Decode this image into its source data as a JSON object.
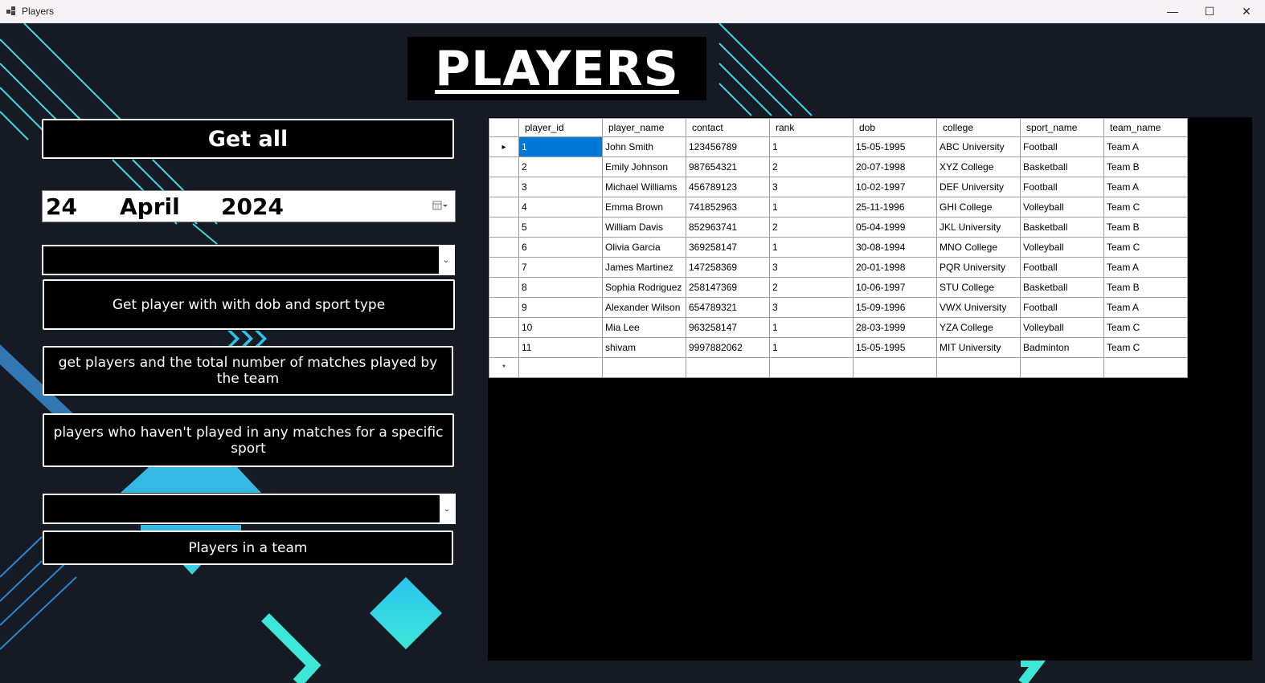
{
  "window": {
    "title": "Players",
    "minimize": "—",
    "maximize": "☐",
    "close": "✕"
  },
  "heading": "PLAYERS",
  "buttons": {
    "get_all": "Get all",
    "dob_sport": "Get player with with dob and sport type",
    "matches": "get players and the total number of matches played by the team",
    "no_matches": "players who haven't played in any matches for a specific sport",
    "team": "Players in a team"
  },
  "date": {
    "day": "24",
    "month": "April",
    "year": "2024"
  },
  "combo_arrow": "⌄",
  "grid": {
    "columns": [
      "player_id",
      "player_name",
      "contact",
      "rank",
      "dob",
      "college",
      "sport_name",
      "team_name"
    ],
    "rows": [
      [
        "1",
        "John Smith",
        "123456789",
        "1",
        "15-05-1995",
        "ABC University",
        "Football",
        "Team A"
      ],
      [
        "2",
        "Emily Johnson",
        "987654321",
        "2",
        "20-07-1998",
        "XYZ College",
        "Basketball",
        "Team B"
      ],
      [
        "3",
        "Michael Williams",
        "456789123",
        "3",
        "10-02-1997",
        "DEF University",
        "Football",
        "Team A"
      ],
      [
        "4",
        "Emma Brown",
        "741852963",
        "1",
        "25-11-1996",
        "GHI College",
        "Volleyball",
        "Team C"
      ],
      [
        "5",
        "William Davis",
        "852963741",
        "2",
        "05-04-1999",
        "JKL University",
        "Basketball",
        "Team B"
      ],
      [
        "6",
        "Olivia Garcia",
        "369258147",
        "1",
        "30-08-1994",
        "MNO College",
        "Volleyball",
        "Team C"
      ],
      [
        "7",
        "James Martinez",
        "147258369",
        "3",
        "20-01-1998",
        "PQR University",
        "Football",
        "Team A"
      ],
      [
        "8",
        "Sophia Rodriguez",
        "258147369",
        "2",
        "10-06-1997",
        "STU College",
        "Basketball",
        "Team B"
      ],
      [
        "9",
        "Alexander Wilson",
        "654789321",
        "3",
        "15-09-1996",
        "VWX University",
        "Football",
        "Team A"
      ],
      [
        "10",
        "Mia Lee",
        "963258147",
        "1",
        "28-03-1999",
        "YZA College",
        "Volleyball",
        "Team C"
      ],
      [
        "11",
        "shivam",
        "9997882062",
        "1",
        "15-05-1995",
        "MIT University",
        "Badminton",
        "Team C"
      ]
    ],
    "current_row_marker": "▸",
    "new_row_marker": "*"
  }
}
